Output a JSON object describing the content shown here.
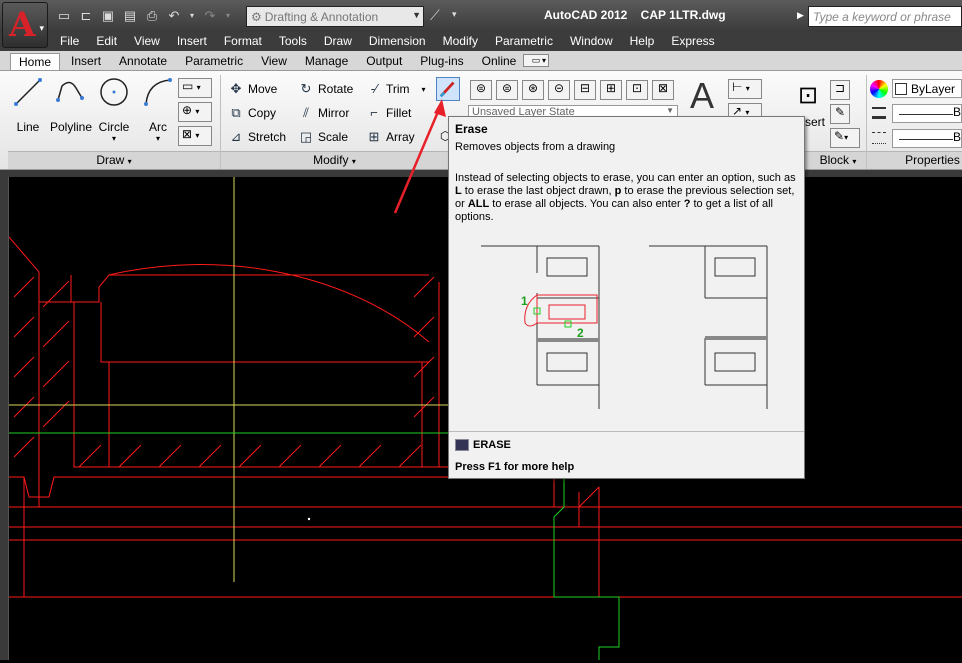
{
  "titlebar": {
    "app_title": "AutoCAD 2012    CAP 1LTR.dwg",
    "workspace": "Drafting & Annotation",
    "search_placeholder": "Type a keyword or phrase"
  },
  "menu": [
    "File",
    "Edit",
    "View",
    "Insert",
    "Format",
    "Tools",
    "Draw",
    "Dimension",
    "Modify",
    "Parametric",
    "Window",
    "Help",
    "Express"
  ],
  "tabs": [
    "Home",
    "Insert",
    "Annotate",
    "Parametric",
    "View",
    "Manage",
    "Output",
    "Plug-ins",
    "Online"
  ],
  "ribbon": {
    "draw": {
      "panel_label": "Draw",
      "line": "Line",
      "polyline": "Polyline",
      "circle": "Circle",
      "arc": "Arc"
    },
    "modify": {
      "panel_label": "Modify",
      "move": "Move",
      "rotate": "Rotate",
      "trim": "Trim",
      "copy": "Copy",
      "mirror": "Mirror",
      "fillet": "Fillet",
      "stretch": "Stretch",
      "scale": "Scale",
      "array": "Array"
    },
    "layers": {
      "layer_state": "Unsaved Layer State"
    },
    "block": {
      "panel_label": "Block",
      "insert_partial": "sert"
    },
    "properties": {
      "panel_label": "Properties",
      "color": "ByLayer",
      "linetype_partial": "B"
    }
  },
  "tooltip": {
    "heading": "Erase",
    "desc": "Removes objects from a drawing",
    "body_parts": [
      "Instead of selecting objects to erase, you can enter an option, such as ",
      "L",
      " to erase the last object drawn, ",
      "p",
      " to erase the previous selection set, or ",
      "ALL",
      " to erase all objects. You can also enter ",
      "?",
      " to get a list of all options."
    ],
    "label1": "1",
    "label2": "2",
    "command": "ERASE",
    "help": "Press F1 for more help"
  },
  "colors": {
    "accent_red": "#e8202a",
    "cad_red": "#ff1a1a",
    "cad_green": "#1fd11f",
    "cad_yellow": "#d8d85a"
  }
}
